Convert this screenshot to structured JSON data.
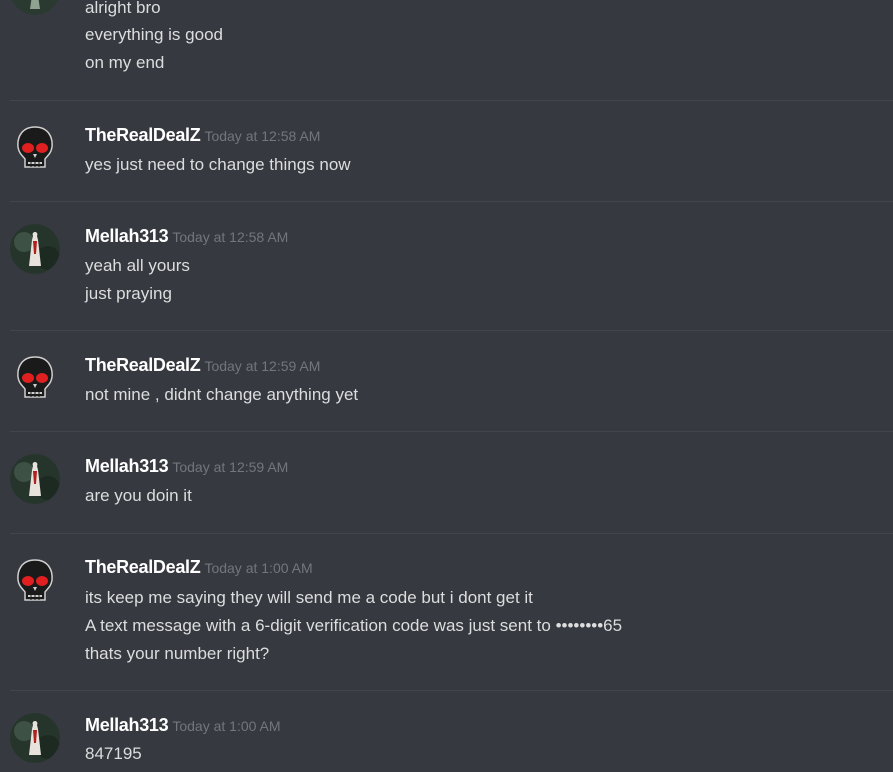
{
  "messages": [
    {
      "author": "",
      "timestamp": "",
      "lines": [
        "alright bro",
        "everything is good",
        "on my end"
      ]
    },
    {
      "author": "TheRealDealZ",
      "timestamp": "Today at 12:58 AM",
      "avatar": "skull-avatar",
      "lines": [
        "yes just need to change things now"
      ]
    },
    {
      "author": "Mellah313",
      "timestamp": "Today at 12:58 AM",
      "avatar": "figure-avatar",
      "lines": [
        "yeah all yours",
        "just praying"
      ]
    },
    {
      "author": "TheRealDealZ",
      "timestamp": "Today at 12:59 AM",
      "avatar": "skull-avatar",
      "lines": [
        "not mine , didnt change anything yet"
      ]
    },
    {
      "author": "Mellah313",
      "timestamp": "Today at 12:59 AM",
      "avatar": "figure-avatar",
      "lines": [
        "are you doin it"
      ]
    },
    {
      "author": "TheRealDealZ",
      "timestamp": "Today at 1:00 AM",
      "avatar": "skull-avatar",
      "lines": [
        "its keep me saying they will send me a code but i dont get it",
        "A text message with a 6-digit verification code was just sent to ••••••••65",
        "thats your number right?"
      ]
    },
    {
      "author": "Mellah313",
      "timestamp": "Today at 1:00 AM",
      "avatar": "figure-avatar",
      "lines": [
        "847195"
      ]
    }
  ],
  "colors": {
    "background": "#36393f",
    "username": "#ffffff",
    "timestamp": "#72767d",
    "message_text": "#dcddde",
    "divider": "#42454a"
  }
}
